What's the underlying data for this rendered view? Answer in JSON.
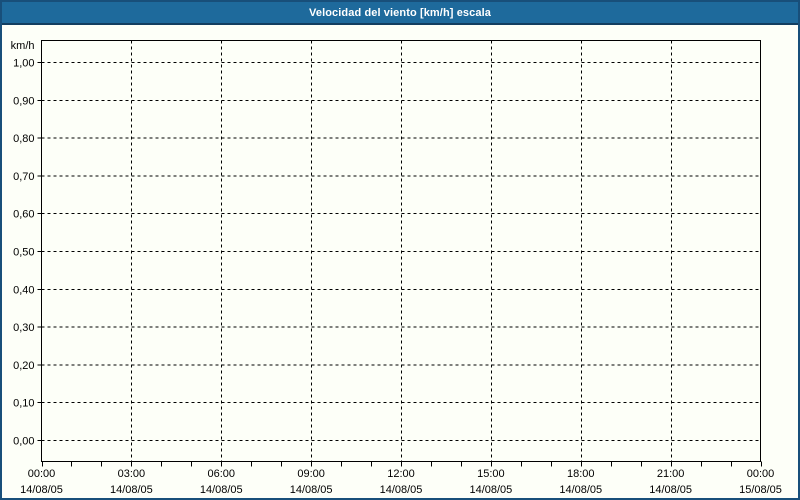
{
  "header": {
    "title": "Velocidad del viento [km/h] escala"
  },
  "colors": {
    "header_bg": "#1E6A9C",
    "header_underline": "#123E60",
    "frame_border": "#184F7A",
    "plot_bg": "#FDFFF8",
    "grid": "#000000",
    "axis": "#000000",
    "title_text": "#FFFFFF",
    "label_text": "#000000"
  },
  "chart_data": {
    "type": "line",
    "title": "Velocidad del viento [km/h] escala",
    "ylabel": "km/h",
    "xlabel": "",
    "ylim": [
      0.0,
      1.0
    ],
    "y_tick_step": 0.1,
    "y_tick_labels": [
      "1,00",
      "0,90",
      "0,80",
      "0,70",
      "0,60",
      "0,50",
      "0,40",
      "0,30",
      "0,20",
      "0,10",
      "0,00"
    ],
    "x_ticks": [
      {
        "time": "00:00",
        "date": "14/08/05"
      },
      {
        "time": "03:00",
        "date": "14/08/05"
      },
      {
        "time": "06:00",
        "date": "14/08/05"
      },
      {
        "time": "09:00",
        "date": "14/08/05"
      },
      {
        "time": "12:00",
        "date": "14/08/05"
      },
      {
        "time": "15:00",
        "date": "14/08/05"
      },
      {
        "time": "18:00",
        "date": "14/08/05"
      },
      {
        "time": "21:00",
        "date": "14/08/05"
      },
      {
        "time": "00:00",
        "date": "15/08/05"
      }
    ],
    "x_major_interval_hours": 3,
    "x_minor_tick_interval_hours": 1,
    "x_total_hours": 24,
    "grid": true,
    "grid_style": "dotted",
    "legend_position": "none",
    "series": []
  }
}
